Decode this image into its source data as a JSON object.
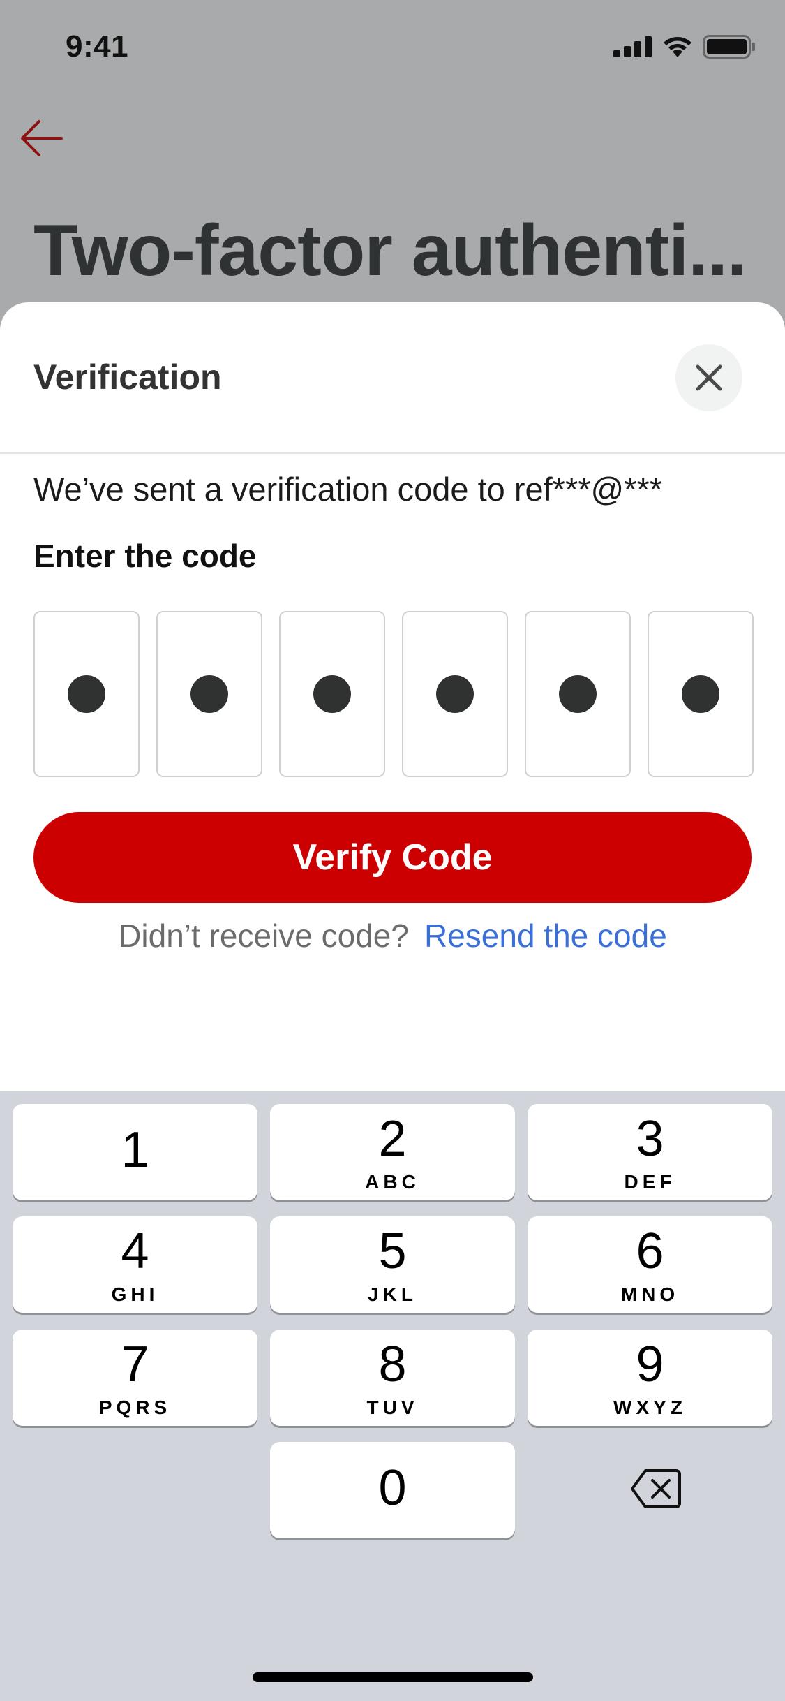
{
  "status_bar": {
    "time": "9:41"
  },
  "background": {
    "title": "Two-factor authenti..."
  },
  "sheet": {
    "title": "Verification",
    "sent_text": "We’ve sent a verification code to ref***@***",
    "enter_label": "Enter the code",
    "code_digits_filled": 6,
    "verify_label": "Verify Code",
    "resend_prompt": "Didn’t receive code?",
    "resend_link": "Resend the code"
  },
  "keyboard": {
    "keys": [
      {
        "digit": "1",
        "letters": ""
      },
      {
        "digit": "2",
        "letters": "ABC"
      },
      {
        "digit": "3",
        "letters": "DEF"
      },
      {
        "digit": "4",
        "letters": "GHI"
      },
      {
        "digit": "5",
        "letters": "JKL"
      },
      {
        "digit": "6",
        "letters": "MNO"
      },
      {
        "digit": "7",
        "letters": "PQRS"
      },
      {
        "digit": "8",
        "letters": "TUV"
      },
      {
        "digit": "9",
        "letters": "WXYZ"
      },
      {
        "digit": "0",
        "letters": ""
      }
    ]
  },
  "colors": {
    "accent": "#cc0000",
    "link": "#3a6fd8",
    "overlay_bg": "#a8aaab",
    "keyboard_bg": "#d1d4db"
  },
  "icons": [
    "back-arrow-icon",
    "close-icon",
    "signal-icon",
    "wifi-icon",
    "battery-icon",
    "delete-icon"
  ]
}
